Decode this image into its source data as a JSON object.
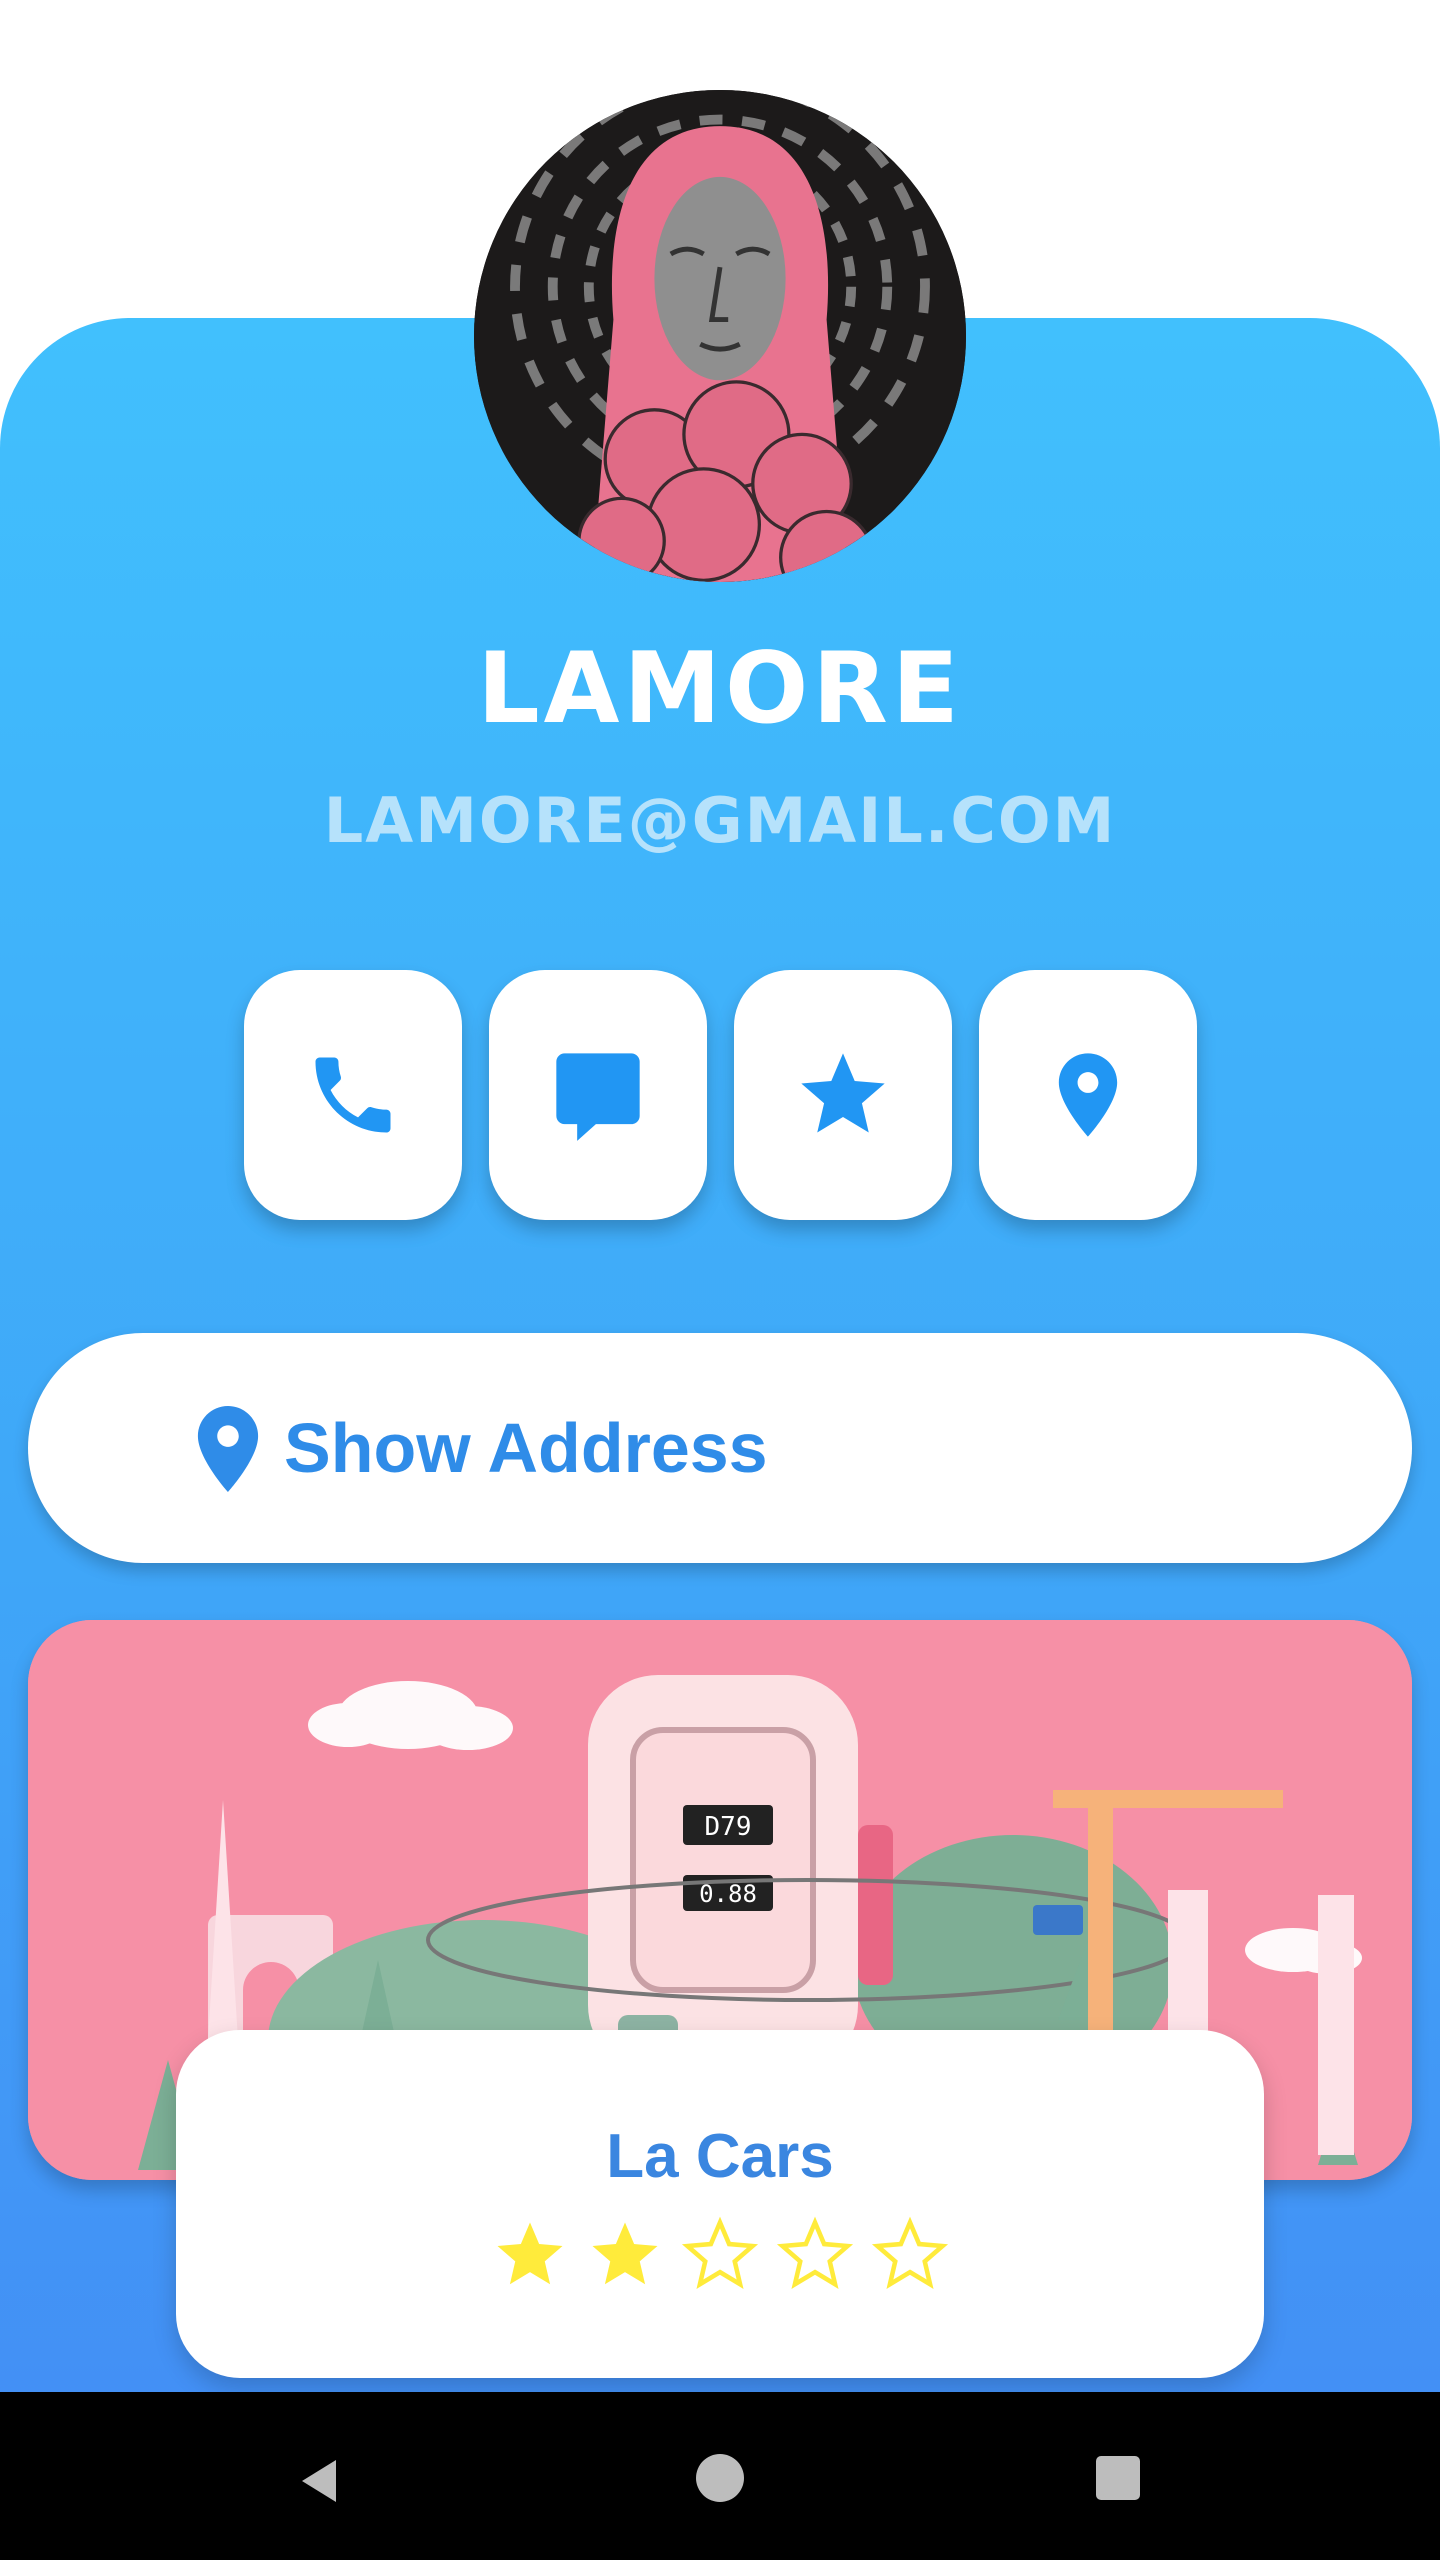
{
  "profile": {
    "name": "LAMORE",
    "email": "LAMORE@GMAIL.COM"
  },
  "actions": [
    {
      "icon": "phone-icon"
    },
    {
      "icon": "message-icon"
    },
    {
      "icon": "star-icon"
    },
    {
      "icon": "location-pin-icon"
    }
  ],
  "address_button": {
    "label": "Show Address",
    "icon": "location-pin-icon"
  },
  "featured": {
    "title": "La Cars",
    "rating": 2,
    "rating_max": 5,
    "banner_text": {
      "counter": "D79",
      "reading": "0.88"
    }
  },
  "colors": {
    "accent": "#2196F3",
    "card_gradient_top": "#41C0FD",
    "card_gradient_bottom": "#4390F5",
    "star_filled": "#FFEB3B",
    "banner_bg": "#F690A6"
  }
}
